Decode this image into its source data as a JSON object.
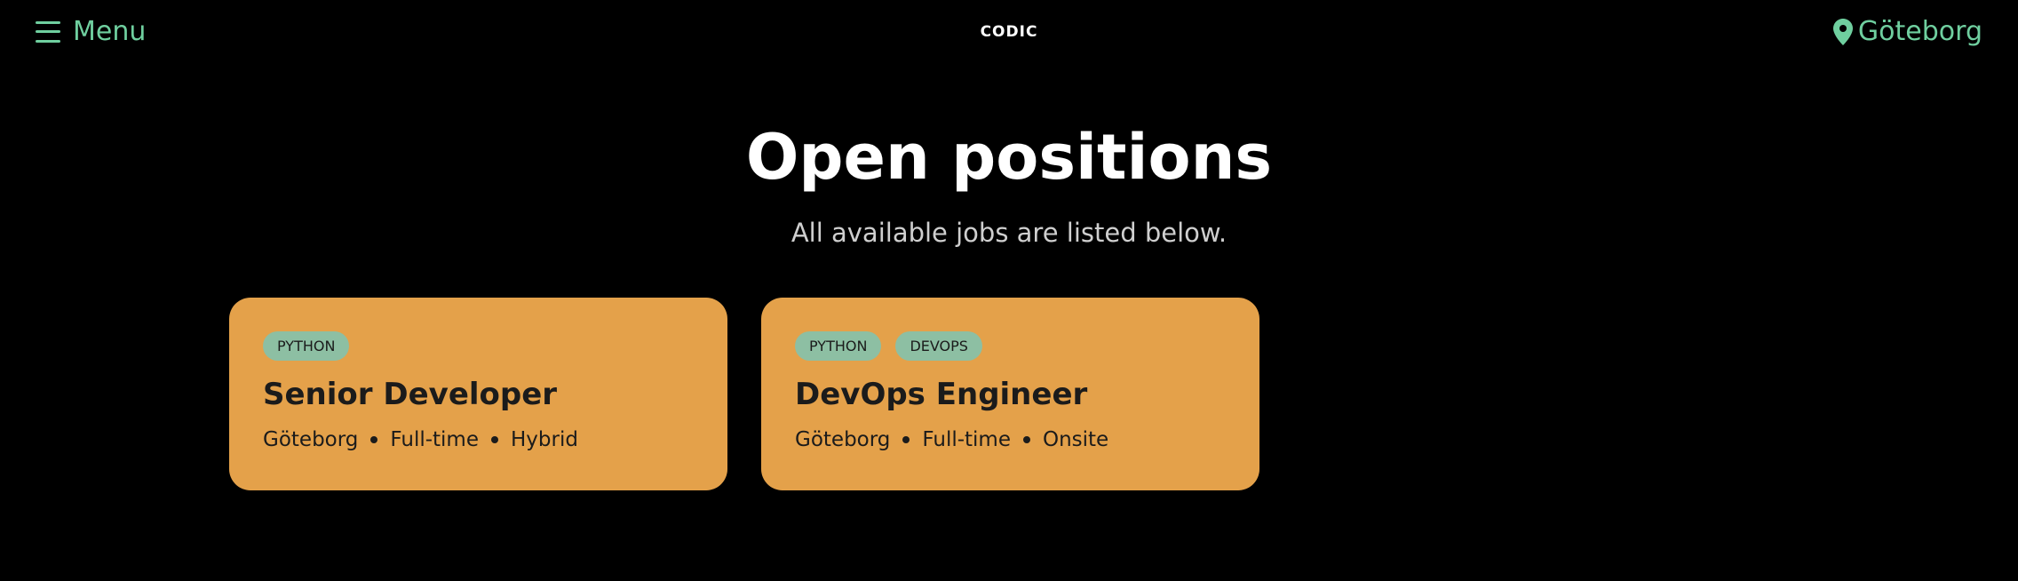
{
  "header": {
    "menu_label": "Menu",
    "logo": "CODIC",
    "location": "Göteborg",
    "accent_color": "#6fcf9f",
    "menu_icon": "hamburger-icon",
    "location_icon": "map-pin-icon"
  },
  "main": {
    "title": "Open positions",
    "subtitle": "All available jobs are listed below.",
    "card_color": "#e4a14a",
    "tag_color": "#8dbfa3",
    "jobs": [
      {
        "tags": [
          "PYTHON"
        ],
        "title": "Senior Developer",
        "location": "Göteborg",
        "type": "Full-time",
        "mode": "Hybrid"
      },
      {
        "tags": [
          "PYTHON",
          "DEVOPS"
        ],
        "title": "DevOps Engineer",
        "location": "Göteborg",
        "type": "Full-time",
        "mode": "Onsite"
      }
    ]
  }
}
